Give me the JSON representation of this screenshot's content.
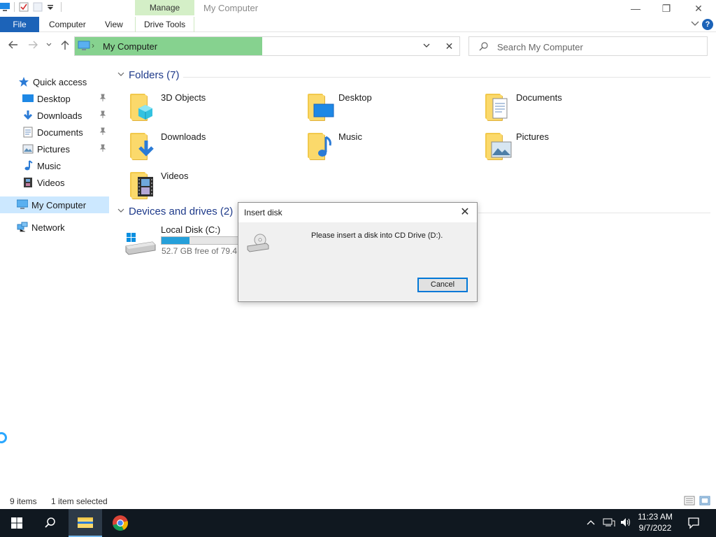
{
  "window": {
    "title": "My Computer",
    "contextual_tab": "Manage",
    "minimize": "—",
    "restore": "❐",
    "close": "✕"
  },
  "ribbon": {
    "tabs": [
      "File",
      "Computer",
      "View",
      "Drive Tools"
    ],
    "help": "?"
  },
  "address": {
    "location": "My Computer",
    "separator": "›"
  },
  "search": {
    "placeholder": "Search My Computer"
  },
  "sidebar": {
    "quick_access": "Quick access",
    "items": [
      {
        "label": "Desktop",
        "pinned": true
      },
      {
        "label": "Downloads",
        "pinned": true
      },
      {
        "label": "Documents",
        "pinned": true
      },
      {
        "label": "Pictures",
        "pinned": true
      },
      {
        "label": "Music",
        "pinned": false
      },
      {
        "label": "Videos",
        "pinned": false
      }
    ],
    "this_pc": "My Computer",
    "network": "Network"
  },
  "content": {
    "folders_header": "Folders (7)",
    "folders": [
      "3D Objects",
      "Desktop",
      "Documents",
      "Downloads",
      "Music",
      "Pictures",
      "Videos"
    ],
    "devices_header": "Devices and drives (2)",
    "drive": {
      "name": "Local Disk (C:)",
      "free_text": "52.7 GB free of 79.4 G",
      "used_fraction": 0.34
    }
  },
  "dialog": {
    "title": "Insert disk",
    "message": "Please insert a disk into CD Drive (D:).",
    "cancel": "Cancel",
    "close": "✕"
  },
  "status": {
    "count": "9 items",
    "selection": "1 item selected"
  },
  "taskbar": {
    "time": "11:23 AM",
    "date": "9/7/2022"
  },
  "colors": {
    "accent": "#1c63b8",
    "address_highlight": "#86d28f",
    "manage_tab": "#d4efc7",
    "taskbar": "#101820",
    "progress": "#26a0da"
  }
}
